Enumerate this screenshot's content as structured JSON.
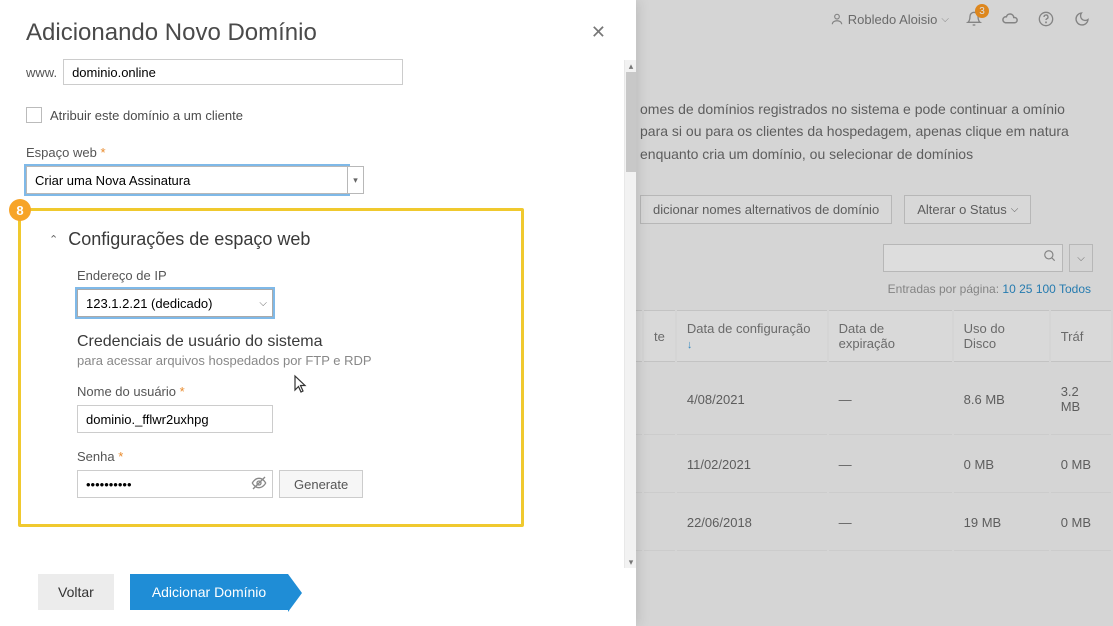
{
  "header": {
    "user_name": "Robledo Aloisio",
    "notif_count": "3"
  },
  "bg": {
    "paragraph": "omes de domínios registrados no sistema e pode continuar a omínio para si ou para os clientes da hospedagem, apenas clique em natura enquanto cria um domínio, ou selecionar de domínios",
    "btn_add_alt": "dicionar nomes alternativos de domínio",
    "btn_status": "Alterar o Status",
    "entries_label": "Entradas por página:",
    "entries_opts": [
      "10",
      "25",
      "100",
      "Todos"
    ],
    "columns": {
      "c1": "te",
      "c2": "Data de configuração",
      "c3": "Data de expiração",
      "c4": "Uso do Disco",
      "c5": "Tráf"
    },
    "rows": [
      {
        "date": "4/08/2021",
        "exp": "—",
        "disk": "8.6 MB",
        "traf": "3.2 MB"
      },
      {
        "date": "11/02/2021",
        "exp": "—",
        "disk": "0 MB",
        "traf": "0 MB"
      },
      {
        "date": "22/06/2018",
        "exp": "—",
        "disk": "19 MB",
        "traf": "0 MB"
      }
    ]
  },
  "modal": {
    "title": "Adicionando Novo Domínio",
    "www_label": "www.",
    "domain_value": "dominio.online",
    "assign_label": "Atribuir este domínio a um cliente",
    "webspace_label": "Espaço web",
    "webspace_value": "Criar uma Nova Assinatura",
    "highlight_num": "8",
    "section_title": "Configurações de espaço web",
    "ip_label": "Endereço de IP",
    "ip_value": "123.1.2.21 (dedicado)",
    "cred_heading": "Credenciais de usuário do sistema",
    "cred_sub": "para acessar arquivos hospedados por FTP e RDP",
    "user_label": "Nome do usuário",
    "user_value": "dominio._fflwr2uxhpg",
    "pwd_label": "Senha",
    "pwd_value": "••••••••••",
    "gen_label": "Generate",
    "back_label": "Voltar",
    "add_label": "Adicionar Domínio"
  }
}
